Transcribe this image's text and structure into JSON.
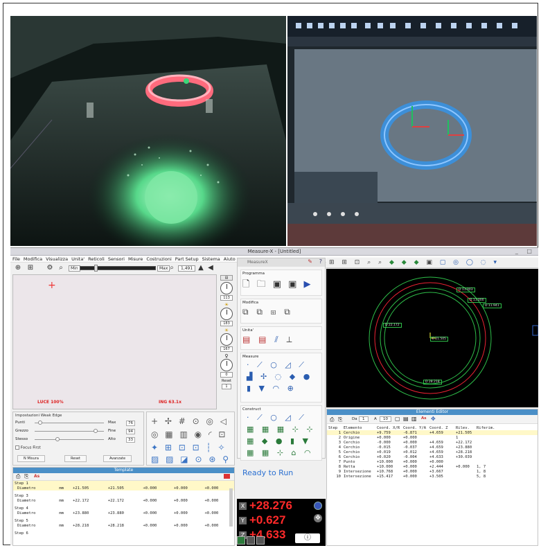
{
  "window": {
    "title": "Measure-X - [Untitled]",
    "menu": [
      "File",
      "Modifica",
      "Visualizza",
      "Unita'",
      "Reticoli",
      "Sensori",
      "Misure",
      "Costruzioni",
      "Part Setup",
      "Sistema",
      "Aiuto"
    ]
  },
  "camera": {
    "zoom_min": "Min",
    "zoom_max": "Max",
    "zoom_value": "1,491",
    "luce_label": "LUCE 100%",
    "ing_label": "ING 63.1x",
    "gauges": [
      "113",
      "183",
      "167",
      "0"
    ],
    "reset_label": "Reset",
    "reset_value": "1"
  },
  "edge": {
    "title": "Impostazioni Weak Edge",
    "rows": [
      {
        "label": "Punti",
        "right": "Max",
        "value": "76"
      },
      {
        "label": "Grezzo",
        "right": "Fine",
        "value": "94"
      },
      {
        "label": "Stesso",
        "right": "Alto",
        "value": "33"
      }
    ],
    "focus_label": "Focus First",
    "buttons": [
      "N Misura",
      "Reset",
      "Avanzate"
    ]
  },
  "program": {
    "title": "MeasureX",
    "sections": [
      "Programma",
      "Modifica",
      "Unita'",
      "Measure",
      "Construct"
    ],
    "status": "Ready to Run"
  },
  "dro": {
    "x_label": "X",
    "x": "+28.276",
    "y_label": "Y",
    "y": "+0.627",
    "z_label": "Z",
    "z": "+4.633"
  },
  "template": {
    "title": "Template",
    "badge": "As",
    "steps": [
      {
        "step": "Step 1",
        "name": "Diametro",
        "unit": "mm",
        "a": "+21.505",
        "b": "+21.505",
        "c": "+0.000",
        "d": "+0.000",
        "e": "+0.000"
      },
      {
        "step": "Step 3",
        "name": "Diametro",
        "unit": "mm",
        "a": "+22.172",
        "b": "+22.172",
        "c": "+0.000",
        "d": "+0.000",
        "e": "+0.000"
      },
      {
        "step": "Step 4",
        "name": "Diametro",
        "unit": "mm",
        "a": "+23.880",
        "b": "+23.880",
        "c": "+0.000",
        "d": "+0.000",
        "e": "+0.000"
      },
      {
        "step": "Step 5",
        "name": "Diametro",
        "unit": "mm",
        "a": "+28.218",
        "b": "+28.218",
        "c": "+0.000",
        "d": "+0.000",
        "e": "+0.000"
      },
      {
        "step": "Step 6",
        "name": "",
        "unit": "",
        "a": "",
        "b": "",
        "c": "",
        "d": "",
        "e": ""
      }
    ]
  },
  "elements": {
    "title": "Elementi Editor",
    "da_label": "Da",
    "da_value": "1",
    "a_label": "A",
    "a_value": "10",
    "headers": [
      "Step",
      "Elemento",
      "Coord. X/R",
      "Coord. Y/A",
      "Coord. Z",
      "Rilev.",
      "Riferim."
    ],
    "rows": [
      {
        "n": "1",
        "el": "Cerchio",
        "x": "+9.759",
        "y": "-6.871",
        "z": "+4.659",
        "r": "+21.505",
        "ref": ""
      },
      {
        "n": "2",
        "el": "Origine",
        "x": "+0.000",
        "y": "+0.000",
        "z": "",
        "r": "1",
        "ref": ""
      },
      {
        "n": "3",
        "el": "Cerchio",
        "x": "-0.000",
        "y": "+0.000",
        "z": "+4.659",
        "r": "+22.172",
        "ref": ""
      },
      {
        "n": "4",
        "el": "Cerchio",
        "x": "-0.015",
        "y": "-0.037",
        "z": "+4.659",
        "r": "+23.880",
        "ref": ""
      },
      {
        "n": "5",
        "el": "Cerchio",
        "x": "+0.019",
        "y": "+0.012",
        "z": "+4.659",
        "r": "+28.218",
        "ref": ""
      },
      {
        "n": "6",
        "el": "Cerchio",
        "x": "+0.020",
        "y": "-0.004",
        "z": "+4.633",
        "r": "+30.039",
        "ref": ""
      },
      {
        "n": "7",
        "el": "Punto",
        "x": "+10.000",
        "y": "+0.000",
        "z": "+0.000",
        "r": "",
        "ref": ""
      },
      {
        "n": "8",
        "el": "Retta",
        "x": "+10.000",
        "y": "+0.000",
        "z": "+2.444",
        "r": "+0.000",
        "ref": "1, 7"
      },
      {
        "n": "9",
        "el": "Intersezione",
        "x": "+10.768",
        "y": "+0.000",
        "z": "+3.667",
        "r": "",
        "ref": "1, 8"
      },
      {
        "n": "10",
        "el": "Intersezione",
        "x": "+15.417",
        "y": "+0.000",
        "z": "+3.505",
        "r": "",
        "ref": "5, 8"
      }
    ]
  },
  "canvas": {
    "labels": [
      "D 11.003",
      "D 11.000",
      "D 11.941",
      "D 22.172",
      "E 21.505",
      "D 28.218"
    ]
  }
}
